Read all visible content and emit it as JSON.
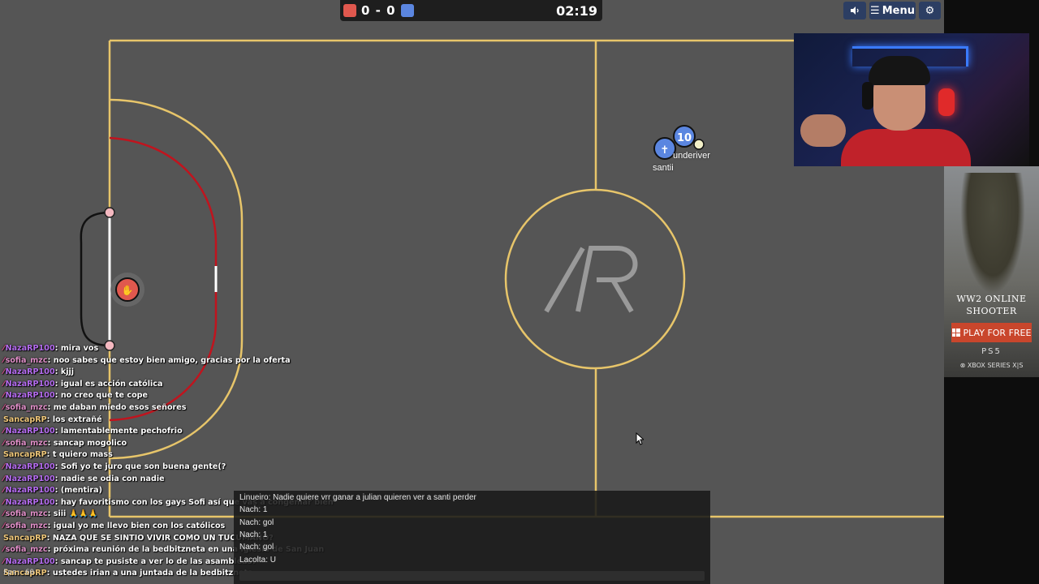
{
  "scoreboard": {
    "score_text": "0 - 0",
    "timer": "02:19",
    "red_color": "#e0584e",
    "blue_color": "#5b86e0"
  },
  "controls": {
    "sound_icon": "speaker-icon",
    "menu_label": "Menu",
    "menu_icon": "hamburger-icon",
    "settings_icon": "gear-icon"
  },
  "field": {
    "center_logo": "/R",
    "line_color": "#e7c56a",
    "goal_area_color": "#c0141e",
    "background": "#555555"
  },
  "players": {
    "blue_player_name": "santii",
    "blue_player_avatar": "✝",
    "blue_teammate_number": "10",
    "blue_teammate_name": "underiver",
    "red_goalkeeper_avatar": "hand-icon"
  },
  "chat": {
    "messages": [
      {
        "user": "NazaRP100",
        "text": "mira vos",
        "badge": true,
        "color": "purple"
      },
      {
        "user": "sofia_mzc",
        "text": "noo sabes que estoy bien amigo, gracias por la oferta",
        "badge": true,
        "color": "pink"
      },
      {
        "user": "NazaRP100",
        "text": "kjjj",
        "badge": true,
        "color": "purple"
      },
      {
        "user": "NazaRP100",
        "text": "igual es acción católica",
        "badge": true,
        "color": "purple"
      },
      {
        "user": "NazaRP100",
        "text": "no creo que te cope",
        "badge": true,
        "color": "purple"
      },
      {
        "user": "sofia_mzc",
        "text": "me daban miedo esos señores",
        "badge": true,
        "color": "pink"
      },
      {
        "user": "SancapRP",
        "text": "los extrañé",
        "badge": false,
        "color": "yellow"
      },
      {
        "user": "NazaRP100",
        "text": "lamentablemente pechofrio",
        "badge": true,
        "color": "purple"
      },
      {
        "user": "sofia_mzc",
        "text": "sancap mogolico",
        "badge": true,
        "color": "pink"
      },
      {
        "user": "SancapRP",
        "text": "t quiero mass",
        "badge": false,
        "color": "yellow"
      },
      {
        "user": "NazaRP100",
        "text": "Sofi yo te juro que son buena gente(?",
        "badge": true,
        "color": "purple"
      },
      {
        "user": "NazaRP100",
        "text": "nadie se odia con nadie",
        "badge": true,
        "color": "purple"
      },
      {
        "user": "NazaRP100",
        "text": "(mentira)",
        "badge": true,
        "color": "purple"
      },
      {
        "user": "NazaRP100",
        "text": "hay favoritismo con los gays Sofi así que vas a congeniar bien",
        "badge": true,
        "color": "purple"
      },
      {
        "user": "sofia_mzc",
        "text": "siii 🙏🙏🙏",
        "badge": true,
        "color": "pink"
      },
      {
        "user": "sofia_mzc",
        "text": "igual yo me llevo bien con los católicos",
        "badge": true,
        "color": "pink"
      },
      {
        "user": "SancapRP",
        "text": "NAZA QUE SE SINTIO VIVIR COMO UN TUCUMANO?",
        "badge": false,
        "color": "yellow"
      },
      {
        "user": "sofia_mzc",
        "text": "próxima reunión de la bedbitzneta en una iglesia de San Juan",
        "badge": true,
        "color": "pink"
      },
      {
        "user": "NazaRP100",
        "text": "sancap te pusiste a ver lo de las asambleas?",
        "badge": true,
        "color": "purple"
      },
      {
        "user": "SancapRP",
        "text": "ustedes irian a una juntada de la bedbitzneta",
        "badge": false,
        "color": "yellow"
      }
    ],
    "fps": "Fps: 60"
  },
  "gamechat": {
    "lines": [
      "Linueiro: Nadie quiere vrr ganar a julian quieren ver a santi perder",
      "Nach: 1",
      "Nach: gol",
      "Nach: 1",
      "Nach: gol",
      "Lacolta: U"
    ],
    "input_placeholder": ""
  },
  "ad": {
    "title_line1": "WW2 ONLINE",
    "title_line2": "SHOOTER",
    "cta": "PLAY FOR FREE",
    "platform1": "PS5",
    "platform2": "XBOX SERIES X|S"
  }
}
